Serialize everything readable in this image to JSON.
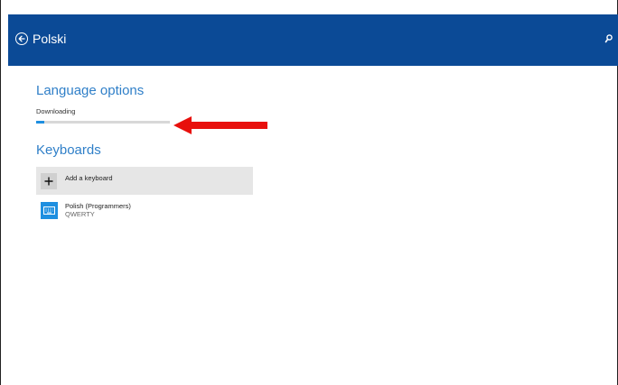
{
  "header": {
    "title": "Polski",
    "back_icon": "back-arrow-circle-icon",
    "search_icon": "search-icon",
    "background": "#0b4a96"
  },
  "language_options": {
    "heading": "Language options",
    "status": "Downloading",
    "progress": 0.06
  },
  "annotation": {
    "icon": "red-arrow-left",
    "color": "#e8100c"
  },
  "keyboards": {
    "heading": "Keyboards",
    "add_label": "Add a keyboard",
    "items": [
      {
        "name": "Polish (Programmers)",
        "layout": "QWERTY",
        "icon": "keyboard-icon"
      }
    ]
  },
  "colors": {
    "accent": "#1e8fe0",
    "heading": "#2f7fc8"
  }
}
